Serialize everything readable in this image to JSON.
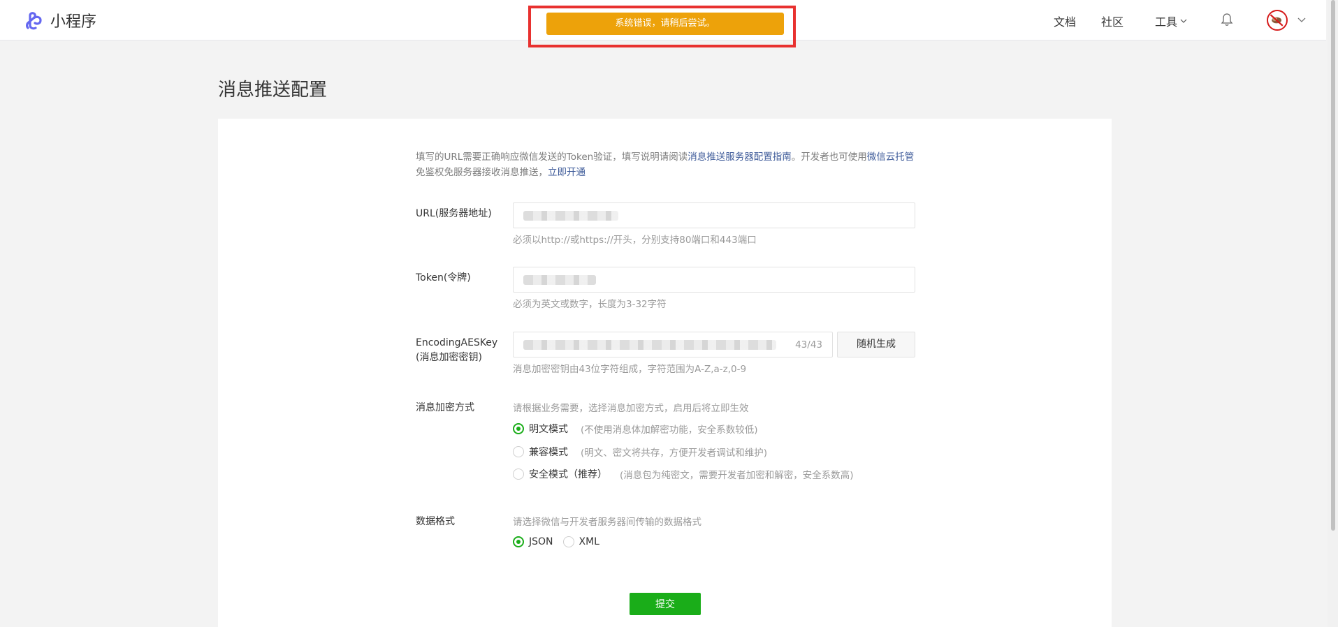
{
  "header": {
    "app_name": "小程序",
    "nav": {
      "docs": "文档",
      "community": "社区",
      "tools": "工具"
    },
    "brand_color": "#6467f0"
  },
  "toast": {
    "message": "系统错误，请稍后尝试。",
    "color": "#eda20a"
  },
  "page": {
    "title": "消息推送配置"
  },
  "intro": {
    "text1": "填写的URL需要正确响应微信发送的Token验证，填写说明请阅读",
    "link1": "消息推送服务器配置指南",
    "text2": "。开发者也可使用",
    "link2": "微信云托管",
    "text3": "免鉴权免服务器接收消息推送，",
    "link3": "立即开通"
  },
  "form": {
    "url": {
      "label": "URL(服务器地址)",
      "tip": "必须以http://或https://开头，分别支持80端口和443端口"
    },
    "token": {
      "label": "Token(令牌)",
      "tip": "必须为英文或数字，长度为3-32字符"
    },
    "aes_key": {
      "label_line1": "EncodingAESKey",
      "label_line2": "(消息加密密钥)",
      "counter": "43/43",
      "random_button": "随机生成",
      "tip": "消息加密密钥由43位字符组成，字符范围为A-Z,a-z,0-9"
    },
    "encryption": {
      "label": "消息加密方式",
      "tip": "请根据业务需要，选择消息加密方式，启用后将立即生效",
      "options": [
        {
          "label": "明文模式",
          "desc": "(不使用消息体加解密功能，安全系数较低)",
          "selected": true
        },
        {
          "label": "兼容模式",
          "desc": "(明文、密文将共存，方便开发者调试和维护)",
          "selected": false
        },
        {
          "label": "安全模式（推荐）",
          "desc": "(消息包为纯密文，需要开发者加密和解密，安全系数高)",
          "selected": false
        }
      ]
    },
    "data_format": {
      "label": "数据格式",
      "tip": "请选择微信与开发者服务器间传输的数据格式",
      "options": [
        {
          "label": "JSON",
          "selected": true
        },
        {
          "label": "XML",
          "selected": false
        }
      ]
    },
    "submit": "提交"
  },
  "accent_color": "#1aad19",
  "icons": [
    "mini-program-logo-icon",
    "chevron-down-icon",
    "bell-icon",
    "avatar",
    "radio-button"
  ]
}
